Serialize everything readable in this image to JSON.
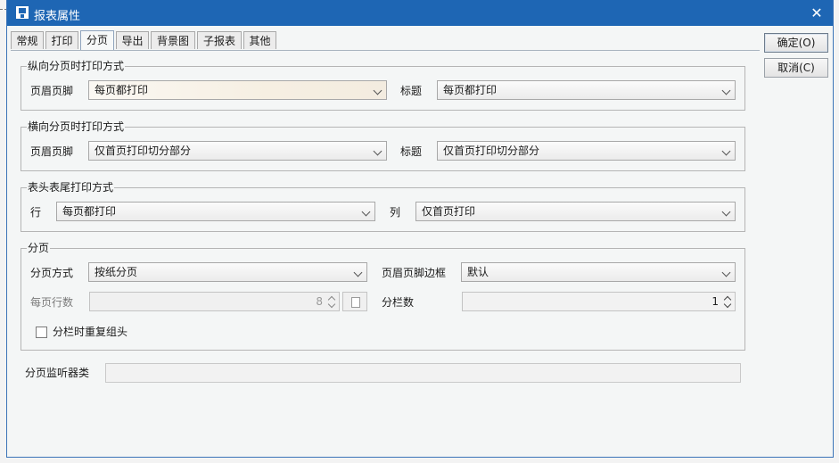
{
  "window": {
    "title": "报表属性",
    "close_glyph": "✕"
  },
  "tabs": [
    {
      "label": "常规"
    },
    {
      "label": "打印"
    },
    {
      "label": "分页",
      "active": true
    },
    {
      "label": "导出"
    },
    {
      "label": "背景图"
    },
    {
      "label": "子报表"
    },
    {
      "label": "其他"
    }
  ],
  "buttons": {
    "ok": "确定(O)",
    "cancel": "取消(C)"
  },
  "vertical": {
    "legend": "纵向分页时打印方式",
    "header_footer_label": "页眉页脚",
    "header_footer_value": "每页都打印",
    "title_label": "标题",
    "title_value": "每页都打印"
  },
  "horizontal": {
    "legend": "横向分页时打印方式",
    "header_footer_label": "页眉页脚",
    "header_footer_value": "仅首页打印切分部分",
    "title_label": "标题",
    "title_value": "仅首页打印切分部分"
  },
  "table_header": {
    "legend": "表头表尾打印方式",
    "row_label": "行",
    "row_value": "每页都打印",
    "col_label": "列",
    "col_value": "仅首页打印"
  },
  "paging": {
    "legend": "分页",
    "mode_label": "分页方式",
    "mode_value": "按纸分页",
    "border_label": "页眉页脚边框",
    "border_value": "默认",
    "rows_label": "每页行数",
    "rows_value": "8",
    "columns_label": "分栏数",
    "columns_value": "1",
    "repeat_label": "分栏时重复组头",
    "repeat_checked": false
  },
  "listener": {
    "label": "分页监听器类",
    "value": ""
  },
  "icons": [
    "window-icon",
    "close-icon",
    "chevron-down-icon",
    "spinner-icon",
    "file-picker-icon"
  ]
}
